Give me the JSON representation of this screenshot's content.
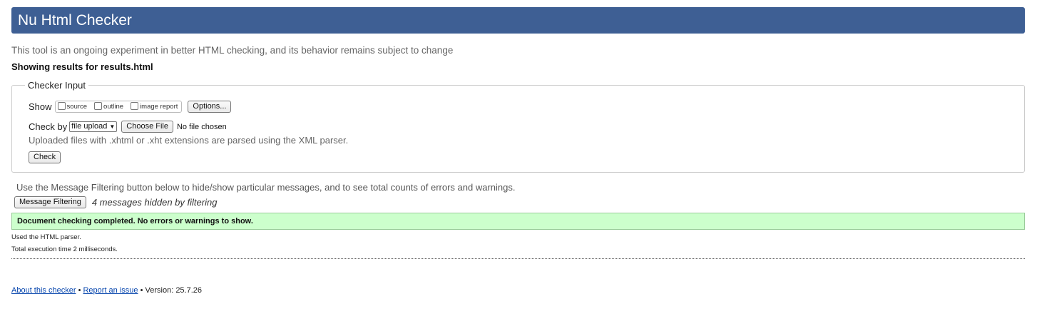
{
  "header": {
    "title": "Nu Html Checker"
  },
  "intro": "This tool is an ongoing experiment in better HTML checking, and its behavior remains subject to change",
  "showing": "Showing results for results.html",
  "checker_input": {
    "legend": "Checker Input",
    "show_label": "Show",
    "show_options": [
      {
        "label": "source",
        "checked": false
      },
      {
        "label": "outline",
        "checked": false
      },
      {
        "label": "image report",
        "checked": false
      }
    ],
    "options_button": "Options...",
    "check_by_label": "Check by",
    "check_by_value": "file upload",
    "choose_file_button": "Choose File",
    "no_file_text": "No file chosen",
    "hint": "Uploaded files with .xhtml or .xht extensions are parsed using the XML parser.",
    "check_button": "Check"
  },
  "filter": {
    "text": "Use the Message Filtering button below to hide/show particular messages, and to see total counts of errors and warnings.",
    "button": "Message Filtering",
    "hidden_count": "4 messages hidden by filtering"
  },
  "result": {
    "message": "Document checking completed. No errors or warnings to show.",
    "color": "#ccffcc"
  },
  "details": {
    "parser": "Used the HTML parser.",
    "time": "Total execution time 2 milliseconds."
  },
  "footer": {
    "about_link": "About this checker",
    "separator": "•",
    "report_link": "Report an issue",
    "version": "Version: 25.7.26"
  },
  "colors": {
    "header_bg": "#3e5f94",
    "link": "#0645ad"
  }
}
